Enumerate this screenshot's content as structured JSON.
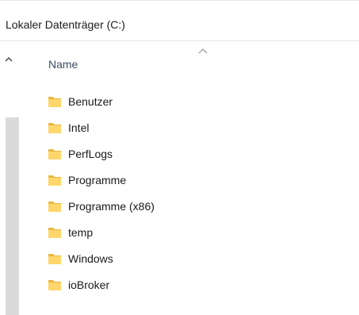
{
  "location": {
    "path_label": "Lokaler Datenträger (C:)"
  },
  "column_header": {
    "name_label": "Name",
    "sort": "ascending"
  },
  "colors": {
    "folder_yellow": "#ffd66b",
    "folder_shade": "#e8b73e",
    "header_text": "#3f4c63"
  },
  "files": [
    {
      "name": "Benutzer",
      "icon": "folder-icon"
    },
    {
      "name": "Intel",
      "icon": "folder-icon"
    },
    {
      "name": "PerfLogs",
      "icon": "folder-icon"
    },
    {
      "name": "Programme",
      "icon": "folder-icon"
    },
    {
      "name": "Programme (x86)",
      "icon": "folder-icon"
    },
    {
      "name": "temp",
      "icon": "folder-icon"
    },
    {
      "name": "Windows",
      "icon": "folder-icon"
    },
    {
      "name": "ioBroker",
      "icon": "folder-icon"
    }
  ]
}
